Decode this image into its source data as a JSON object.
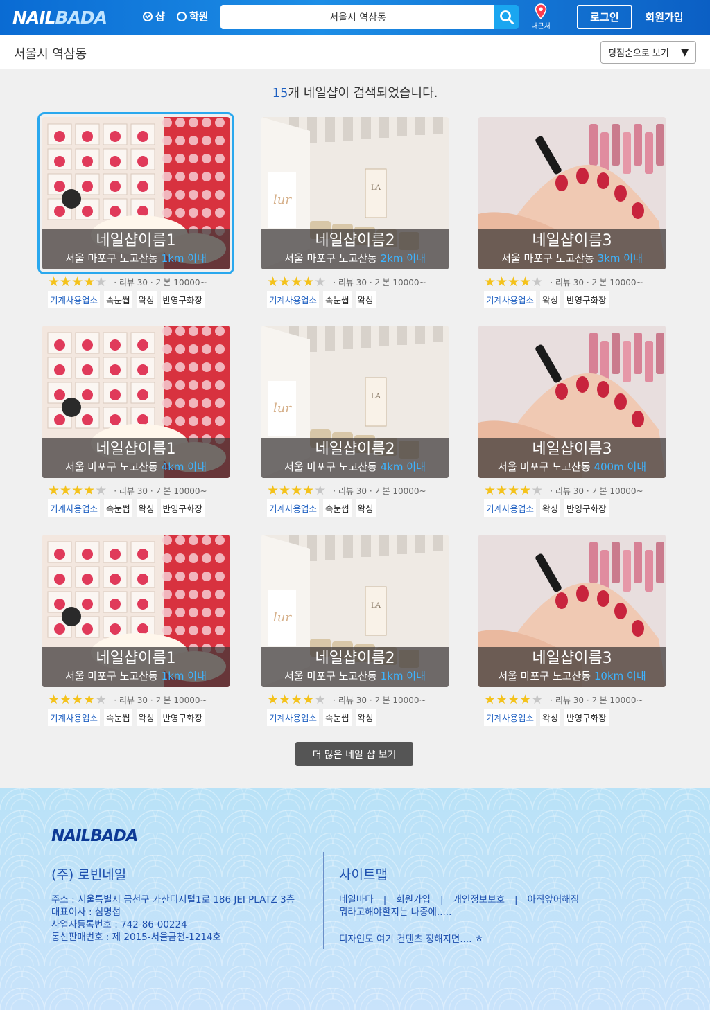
{
  "header": {
    "logo_a": "NAIL",
    "logo_b": "BADA",
    "radio_shop": "샵",
    "radio_academy": "학원",
    "search_value": "서울시 역삼동",
    "nearby_label": "내근처",
    "login_label": "로그인",
    "join_label": "회원가입"
  },
  "subbar": {
    "location_title": "서울시 역삼동",
    "sort_label": "평점순으로 보기",
    "sort_caret": "▼"
  },
  "results": {
    "count": "15",
    "count_text": "개 네일샵이 검색되었습니다."
  },
  "cards": [
    {
      "name": "네일샵이름1",
      "addr": "서울 마포구 노고산동",
      "dist": "1km 이내",
      "rating": 4,
      "meta": "· 리뷰 30 · 기본 10000~",
      "tags": [
        "기계사용업소",
        "속눈썹",
        "왁싱",
        "반영구화장"
      ]
    },
    {
      "name": "네일샵이름2",
      "addr": "서울 마포구 노고산동",
      "dist": "2km 이내",
      "rating": 4,
      "meta": "· 리뷰 30 · 기본 10000~",
      "tags": [
        "기계사용업소",
        "속눈썹",
        "왁싱"
      ]
    },
    {
      "name": "네일샵이름3",
      "addr": "서울 마포구 노고산동",
      "dist": "3km 이내",
      "rating": 4,
      "meta": "· 리뷰 30 · 기본 10000~",
      "tags": [
        "기계사용업소",
        "왁싱",
        "반영구화장"
      ]
    },
    {
      "name": "네일샵이름1",
      "addr": "서울 마포구 노고산동",
      "dist": "4km 이내",
      "rating": 4,
      "meta": "· 리뷰 30 · 기본 10000~",
      "tags": [
        "기계사용업소",
        "속눈썹",
        "왁싱",
        "반영구화장"
      ]
    },
    {
      "name": "네일샵이름2",
      "addr": "서울 마포구 노고산동",
      "dist": "4km 이내",
      "rating": 4,
      "meta": "· 리뷰 30 · 기본 10000~",
      "tags": [
        "기계사용업소",
        "속눈썹",
        "왁싱"
      ]
    },
    {
      "name": "네일샵이름3",
      "addr": "서울 마포구 노고산동",
      "dist": "400m 이내",
      "rating": 4,
      "meta": "· 리뷰 30 · 기본 10000~",
      "tags": [
        "기계사용업소",
        "왁싱",
        "반영구화장"
      ]
    },
    {
      "name": "네일샵이름1",
      "addr": "서울 마포구 노고산동",
      "dist": "1km 이내",
      "rating": 4,
      "meta": "· 리뷰 30 · 기본 10000~",
      "tags": [
        "기계사용업소",
        "속눈썹",
        "왁싱",
        "반영구화장"
      ]
    },
    {
      "name": "네일샵이름2",
      "addr": "서울 마포구 노고산동",
      "dist": "1km 이내",
      "rating": 4,
      "meta": "· 리뷰 30 · 기본 10000~",
      "tags": [
        "기계사용업소",
        "속눈썹",
        "왁싱"
      ]
    },
    {
      "name": "네일샵이름3",
      "addr": "서울 마포구 노고산동",
      "dist": "10km 이내",
      "rating": 4,
      "meta": "· 리뷰 30 · 기본 10000~",
      "tags": [
        "기계사용업소",
        "왁싱",
        "반영구화장"
      ]
    }
  ],
  "more_label": "더 많은 네일 샵 보기",
  "footer": {
    "logo": "NAILBADA",
    "company": "(주) 로빈네일",
    "info": [
      "주소 : 서울특별시 금천구 가산디지털1로 186 JEI PLATZ 3층",
      "대표이사 : 심명섭",
      "사업자등록번호 : 742-86-00224",
      "통신판매번호 : 제 2015-서울금천-1214호"
    ],
    "sitemap_title": "사이트맵",
    "links": [
      "네일바다",
      "회원가입",
      "개인정보보호",
      "아직앞어해짐"
    ],
    "link_sep": "|",
    "links_line2": "뭐라고해야할지는 나중에.....",
    "note": "디자인도 여기 컨텐츠 정해지면.... ㅎ"
  },
  "colors": {
    "header_blue": "#1d8ee6",
    "accent_blue": "#1d5fc1",
    "distance_blue": "#3db4ff",
    "star_yellow": "#f4c21b",
    "selected_outline": "#2aa8ee"
  }
}
